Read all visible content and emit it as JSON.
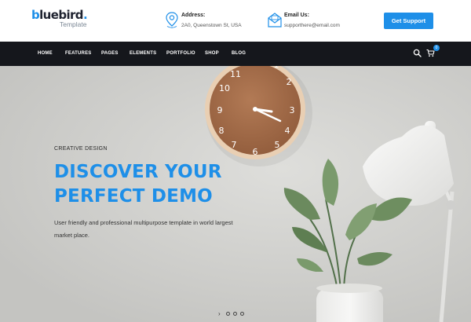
{
  "brand": {
    "name_b": "b",
    "name_rest": "luebird",
    "dot": ".",
    "tagline": "Template"
  },
  "contact": {
    "address": {
      "title": "Address:",
      "text": "2A0, Queenstown St, USA"
    },
    "email": {
      "title": "Email Us:",
      "text": "supporthere@email.com"
    }
  },
  "header": {
    "cta_label": "Get Support"
  },
  "nav": {
    "items": [
      "HOME",
      "FEATURES",
      "PAGES",
      "ELEMENTS",
      "PORTFOLIO",
      "SHOP",
      "BLOG"
    ],
    "cart_count": "0"
  },
  "hero": {
    "eyebrow": "CREATIVE DESIGN",
    "title_line1": "DISCOVER YOUR",
    "title_line2": "PERFECT DEMO",
    "description": "User friendly and professional multipurpose template in world largest market place."
  },
  "slider": {
    "prev_glyph": "›",
    "dot_count": 3,
    "active_index": 0
  },
  "colors": {
    "accent": "#1e8fe8",
    "nav_bg": "#15171c",
    "dark_text": "#1f2330"
  },
  "icons": [
    "map-pin-icon",
    "envelope-icon",
    "search-icon",
    "cart-icon",
    "clock-image",
    "lamp-image",
    "plant-image"
  ]
}
